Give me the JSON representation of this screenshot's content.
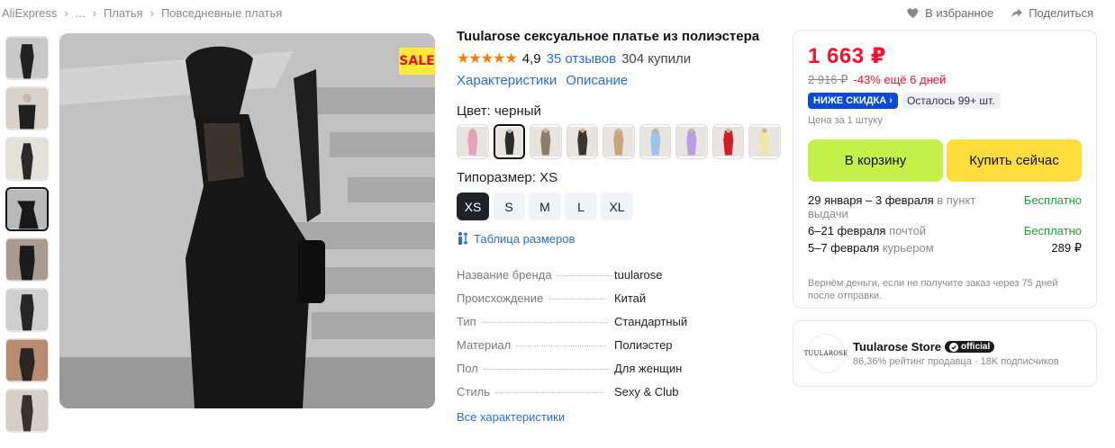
{
  "breadcrumb": [
    "AliExpress",
    "...",
    "Платья",
    "Повседневные платья"
  ],
  "top_actions": {
    "favorite": "В избранное",
    "share": "Поделиться"
  },
  "main": {
    "sale_badge": "SALE"
  },
  "product": {
    "title": "Tuularose сексуальное платье из полиэстера",
    "stars": "★★★★★",
    "rating": "4,9",
    "reviews": "35 отзывов",
    "bought": "304 купили",
    "link_specs": "Характеристики",
    "link_desc": "Описание",
    "color_label": "Цвет: черный",
    "swatch_colors": [
      "#e6a2b8",
      "#2a2a2a",
      "#8a7f6a",
      "#3d3530",
      "#c9a67a",
      "#9fc4e6",
      "#b8a0e0",
      "#d11f2a",
      "#f0e6a8"
    ],
    "size_label": "Типоразмер: XS",
    "sizes": [
      "XS",
      "S",
      "M",
      "L",
      "XL"
    ],
    "size_table": "Таблица размеров",
    "specs": [
      {
        "k": "Название бренда",
        "v": "tuularose"
      },
      {
        "k": "Происхождение",
        "v": "Китай"
      },
      {
        "k": "Тип",
        "v": "Стандартный"
      },
      {
        "k": "Материал",
        "v": "Полиэстер"
      },
      {
        "k": "Пол",
        "v": "Для женщин"
      },
      {
        "k": "Стиль",
        "v": "Sexy & Club"
      }
    ],
    "all_specs": "Все характеристики"
  },
  "buybox": {
    "price": "1 663 ₽",
    "old_price": "2 916 ₽",
    "discount": "-43% ещё 6 дней",
    "low_price_badge": "НИЖЕ СКИДКА ›",
    "stock": "Осталось 99+ шт.",
    "unit": "Цена за 1 штуку",
    "cart": "В корзину",
    "buy_now": "Купить сейчас",
    "delivery": [
      {
        "date": "29 января – 3 февраля",
        "method": " в пункт выдачи",
        "price": "Бесплатно",
        "free": true
      },
      {
        "date": "6–21 февраля",
        "method": " почтой",
        "price": "Бесплатно",
        "free": true
      },
      {
        "date": "5–7 февраля",
        "method": " курьером",
        "price": "289 ₽",
        "free": false
      }
    ],
    "refund": "Вернём деньги, если не получите заказ через 75 дней после отправки."
  },
  "store": {
    "logo_text": "TUULAROSE",
    "name": "Tuularose Store",
    "official": "official",
    "rating": "86,36% рейтинг продавца",
    "subscribers": "18K подписчиков"
  }
}
